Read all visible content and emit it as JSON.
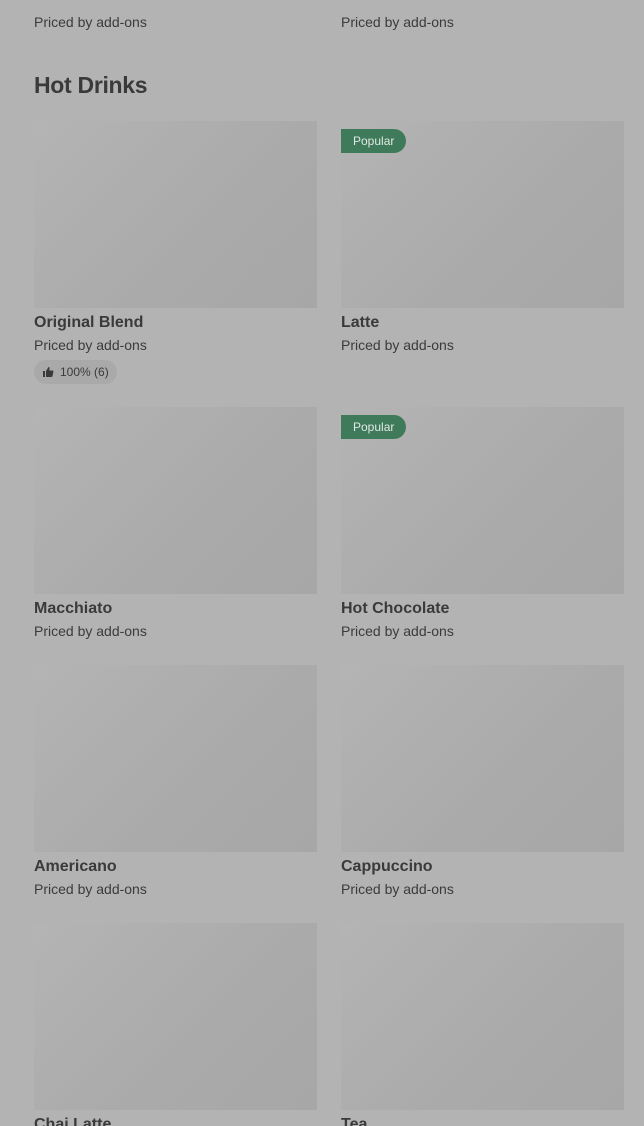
{
  "previous_section": {
    "items": [
      {
        "price_text": "Priced by add-ons"
      },
      {
        "price_text": "Priced by add-ons"
      }
    ]
  },
  "section": {
    "title": "Hot Drinks",
    "items": [
      {
        "name": "Original Blend",
        "price_text": "Priced by add-ons",
        "badge": "",
        "rating": "100% (6)"
      },
      {
        "name": "Latte",
        "price_text": "Priced by add-ons",
        "badge": "Popular",
        "rating": ""
      },
      {
        "name": "Macchiato",
        "price_text": "Priced by add-ons",
        "badge": "",
        "rating": ""
      },
      {
        "name": "Hot Chocolate",
        "price_text": "Priced by add-ons",
        "badge": "Popular",
        "rating": ""
      },
      {
        "name": "Americano",
        "price_text": "Priced by add-ons",
        "badge": "",
        "rating": ""
      },
      {
        "name": "Cappuccino",
        "price_text": "Priced by add-ons",
        "badge": "",
        "rating": ""
      },
      {
        "name": "Chai Latte",
        "price_text": "",
        "badge": "",
        "rating": ""
      },
      {
        "name": "Tea",
        "price_text": "",
        "badge": "",
        "rating": ""
      }
    ]
  },
  "colors": {
    "background": "#b3b3b3",
    "badge": "#3f7a5b"
  },
  "icons": {
    "rating": "thumbs-up-icon"
  }
}
